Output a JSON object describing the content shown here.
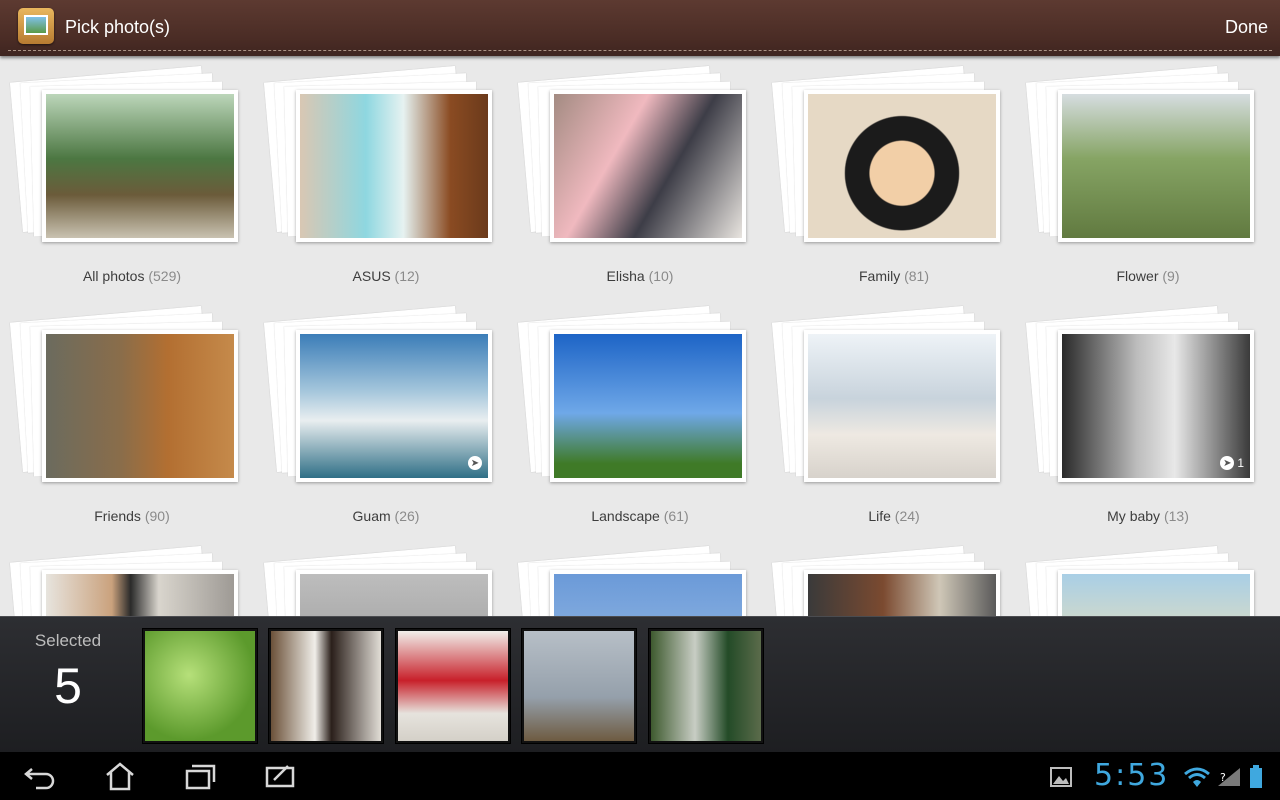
{
  "header": {
    "title": "Pick photo(s)",
    "done_label": "Done"
  },
  "albums": [
    {
      "name": "All photos",
      "count": "(529)"
    },
    {
      "name": "ASUS",
      "count": "(12)"
    },
    {
      "name": "Elisha",
      "count": "(10)"
    },
    {
      "name": "Family",
      "count": "(81)"
    },
    {
      "name": "Flower",
      "count": "(9)"
    },
    {
      "name": "Friends",
      "count": "(90)"
    },
    {
      "name": "Guam",
      "count": "(26)"
    },
    {
      "name": "Landscape",
      "count": "(61)"
    },
    {
      "name": "Life",
      "count": "(24)"
    },
    {
      "name": "My baby",
      "count": "(13)"
    }
  ],
  "badges": {
    "my_baby_count": "1"
  },
  "tray": {
    "title": "Selected",
    "count": "5"
  },
  "status": {
    "clock": "5:53"
  },
  "icons": {
    "back": "back-icon",
    "home": "home-icon",
    "recent": "recent-apps-icon",
    "screenshot": "screenshot-icon",
    "gallery": "gallery-icon",
    "wifi": "wifi-icon",
    "signal": "signal-icon",
    "battery": "battery-icon",
    "location": "location-icon"
  },
  "colors": {
    "header": "#4a2c25",
    "clock": "#3fa8df",
    "grid_bg": "#e9e9e9"
  }
}
